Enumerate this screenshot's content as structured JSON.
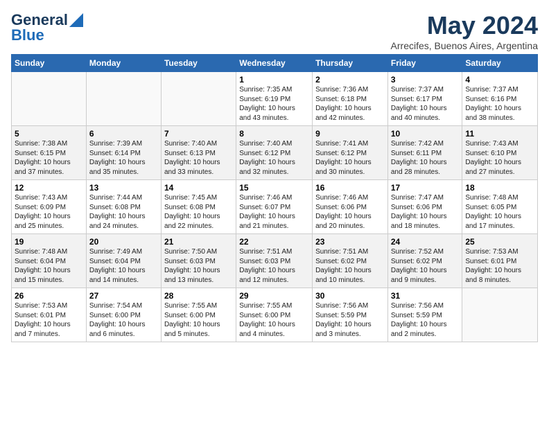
{
  "header": {
    "logo_line1": "General",
    "logo_line2": "Blue",
    "title": "May 2024",
    "subtitle": "Arrecifes, Buenos Aires, Argentina"
  },
  "days_of_week": [
    "Sunday",
    "Monday",
    "Tuesday",
    "Wednesday",
    "Thursday",
    "Friday",
    "Saturday"
  ],
  "weeks": [
    {
      "days": [
        {
          "num": "",
          "info": ""
        },
        {
          "num": "",
          "info": ""
        },
        {
          "num": "",
          "info": ""
        },
        {
          "num": "1",
          "info": "Sunrise: 7:35 AM\nSunset: 6:19 PM\nDaylight: 10 hours\nand 43 minutes."
        },
        {
          "num": "2",
          "info": "Sunrise: 7:36 AM\nSunset: 6:18 PM\nDaylight: 10 hours\nand 42 minutes."
        },
        {
          "num": "3",
          "info": "Sunrise: 7:37 AM\nSunset: 6:17 PM\nDaylight: 10 hours\nand 40 minutes."
        },
        {
          "num": "4",
          "info": "Sunrise: 7:37 AM\nSunset: 6:16 PM\nDaylight: 10 hours\nand 38 minutes."
        }
      ]
    },
    {
      "days": [
        {
          "num": "5",
          "info": "Sunrise: 7:38 AM\nSunset: 6:15 PM\nDaylight: 10 hours\nand 37 minutes."
        },
        {
          "num": "6",
          "info": "Sunrise: 7:39 AM\nSunset: 6:14 PM\nDaylight: 10 hours\nand 35 minutes."
        },
        {
          "num": "7",
          "info": "Sunrise: 7:40 AM\nSunset: 6:13 PM\nDaylight: 10 hours\nand 33 minutes."
        },
        {
          "num": "8",
          "info": "Sunrise: 7:40 AM\nSunset: 6:12 PM\nDaylight: 10 hours\nand 32 minutes."
        },
        {
          "num": "9",
          "info": "Sunrise: 7:41 AM\nSunset: 6:12 PM\nDaylight: 10 hours\nand 30 minutes."
        },
        {
          "num": "10",
          "info": "Sunrise: 7:42 AM\nSunset: 6:11 PM\nDaylight: 10 hours\nand 28 minutes."
        },
        {
          "num": "11",
          "info": "Sunrise: 7:43 AM\nSunset: 6:10 PM\nDaylight: 10 hours\nand 27 minutes."
        }
      ]
    },
    {
      "days": [
        {
          "num": "12",
          "info": "Sunrise: 7:43 AM\nSunset: 6:09 PM\nDaylight: 10 hours\nand 25 minutes."
        },
        {
          "num": "13",
          "info": "Sunrise: 7:44 AM\nSunset: 6:08 PM\nDaylight: 10 hours\nand 24 minutes."
        },
        {
          "num": "14",
          "info": "Sunrise: 7:45 AM\nSunset: 6:08 PM\nDaylight: 10 hours\nand 22 minutes."
        },
        {
          "num": "15",
          "info": "Sunrise: 7:46 AM\nSunset: 6:07 PM\nDaylight: 10 hours\nand 21 minutes."
        },
        {
          "num": "16",
          "info": "Sunrise: 7:46 AM\nSunset: 6:06 PM\nDaylight: 10 hours\nand 20 minutes."
        },
        {
          "num": "17",
          "info": "Sunrise: 7:47 AM\nSunset: 6:06 PM\nDaylight: 10 hours\nand 18 minutes."
        },
        {
          "num": "18",
          "info": "Sunrise: 7:48 AM\nSunset: 6:05 PM\nDaylight: 10 hours\nand 17 minutes."
        }
      ]
    },
    {
      "days": [
        {
          "num": "19",
          "info": "Sunrise: 7:48 AM\nSunset: 6:04 PM\nDaylight: 10 hours\nand 15 minutes."
        },
        {
          "num": "20",
          "info": "Sunrise: 7:49 AM\nSunset: 6:04 PM\nDaylight: 10 hours\nand 14 minutes."
        },
        {
          "num": "21",
          "info": "Sunrise: 7:50 AM\nSunset: 6:03 PM\nDaylight: 10 hours\nand 13 minutes."
        },
        {
          "num": "22",
          "info": "Sunrise: 7:51 AM\nSunset: 6:03 PM\nDaylight: 10 hours\nand 12 minutes."
        },
        {
          "num": "23",
          "info": "Sunrise: 7:51 AM\nSunset: 6:02 PM\nDaylight: 10 hours\nand 10 minutes."
        },
        {
          "num": "24",
          "info": "Sunrise: 7:52 AM\nSunset: 6:02 PM\nDaylight: 10 hours\nand 9 minutes."
        },
        {
          "num": "25",
          "info": "Sunrise: 7:53 AM\nSunset: 6:01 PM\nDaylight: 10 hours\nand 8 minutes."
        }
      ]
    },
    {
      "days": [
        {
          "num": "26",
          "info": "Sunrise: 7:53 AM\nSunset: 6:01 PM\nDaylight: 10 hours\nand 7 minutes."
        },
        {
          "num": "27",
          "info": "Sunrise: 7:54 AM\nSunset: 6:00 PM\nDaylight: 10 hours\nand 6 minutes."
        },
        {
          "num": "28",
          "info": "Sunrise: 7:55 AM\nSunset: 6:00 PM\nDaylight: 10 hours\nand 5 minutes."
        },
        {
          "num": "29",
          "info": "Sunrise: 7:55 AM\nSunset: 6:00 PM\nDaylight: 10 hours\nand 4 minutes."
        },
        {
          "num": "30",
          "info": "Sunrise: 7:56 AM\nSunset: 5:59 PM\nDaylight: 10 hours\nand 3 minutes."
        },
        {
          "num": "31",
          "info": "Sunrise: 7:56 AM\nSunset: 5:59 PM\nDaylight: 10 hours\nand 2 minutes."
        },
        {
          "num": "",
          "info": ""
        }
      ]
    }
  ]
}
